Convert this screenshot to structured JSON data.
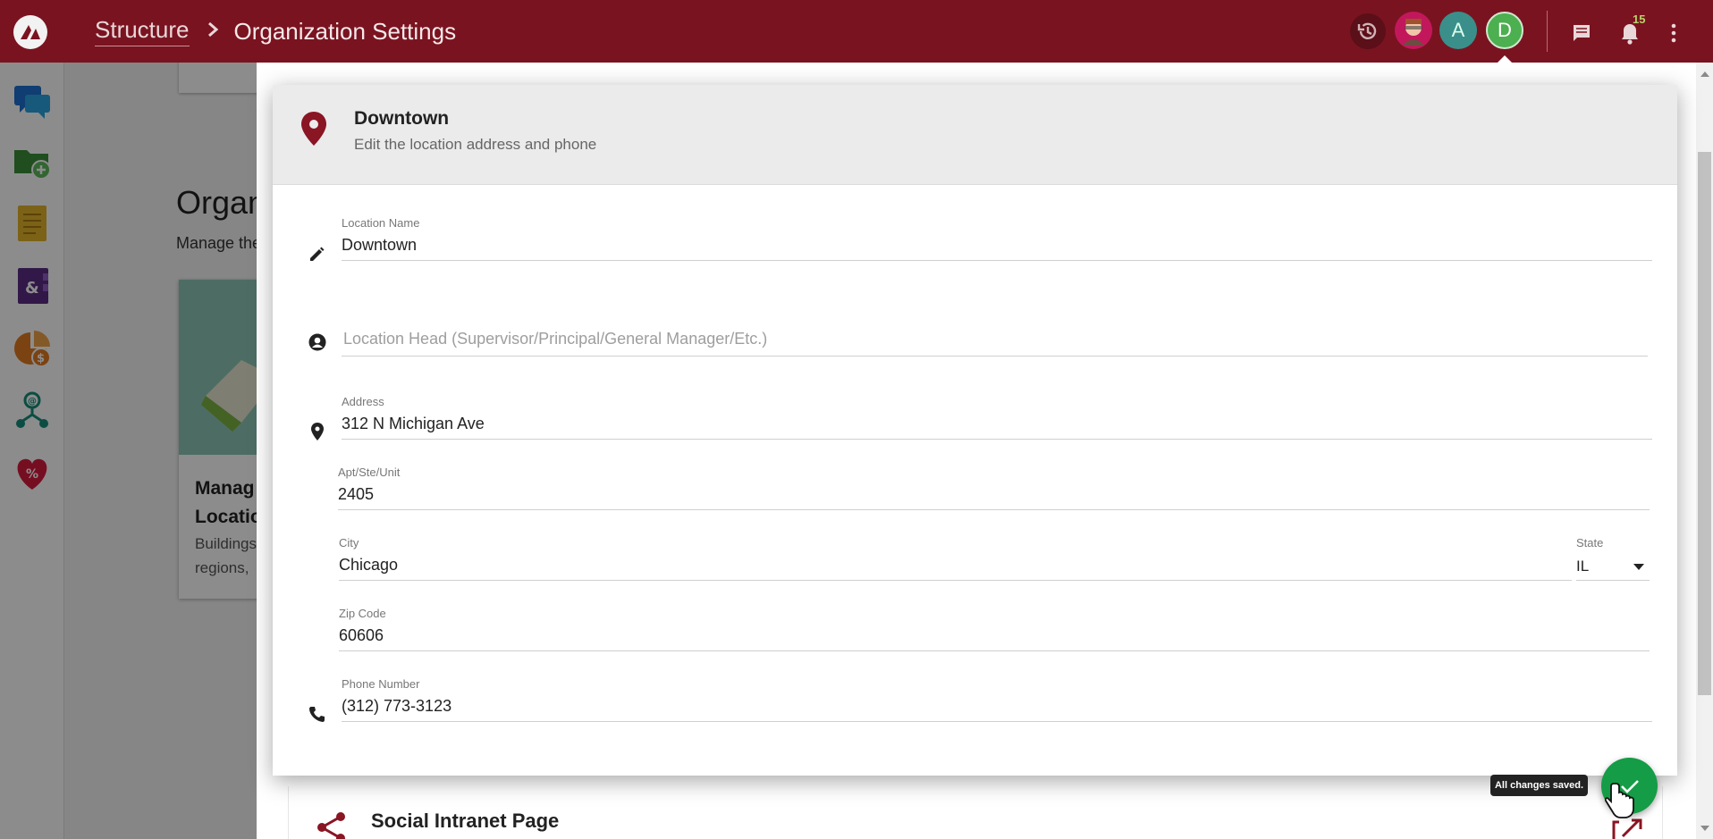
{
  "header": {
    "breadcrumb_parent": "Structure",
    "breadcrumb_separator": ">",
    "breadcrumb_current": "Organization Settings",
    "avatars": [
      "A",
      "D"
    ],
    "notification_count": "15",
    "accent_color": "#7a1320"
  },
  "background": {
    "page_title": "Organ",
    "page_subtitle": "Manage the",
    "card_title_line1": "Manag",
    "card_title_line2": "Locatio",
    "card_text_line1": "Buildings",
    "card_text_line2": "regions,",
    "section_social": "Social Intranet Page"
  },
  "dialog": {
    "title": "Downtown",
    "subtitle": "Edit the location address and phone",
    "fields": {
      "location_name": {
        "label": "Location Name",
        "value": "Downtown"
      },
      "location_head": {
        "placeholder": "Location Head (Supervisor/Principal/General Manager/Etc.)"
      },
      "address": {
        "label": "Address",
        "value": "312 N Michigan Ave"
      },
      "apt": {
        "label": "Apt/Ste/Unit",
        "value": "2405"
      },
      "city": {
        "label": "City",
        "value": "Chicago"
      },
      "state": {
        "label": "State",
        "value": "IL"
      },
      "zip": {
        "label": "Zip Code",
        "value": "60606"
      },
      "phone": {
        "label": "Phone Number",
        "value": "(312) 773-3123"
      }
    }
  },
  "save": {
    "tooltip": "All changes saved.",
    "color": "#159c46"
  }
}
